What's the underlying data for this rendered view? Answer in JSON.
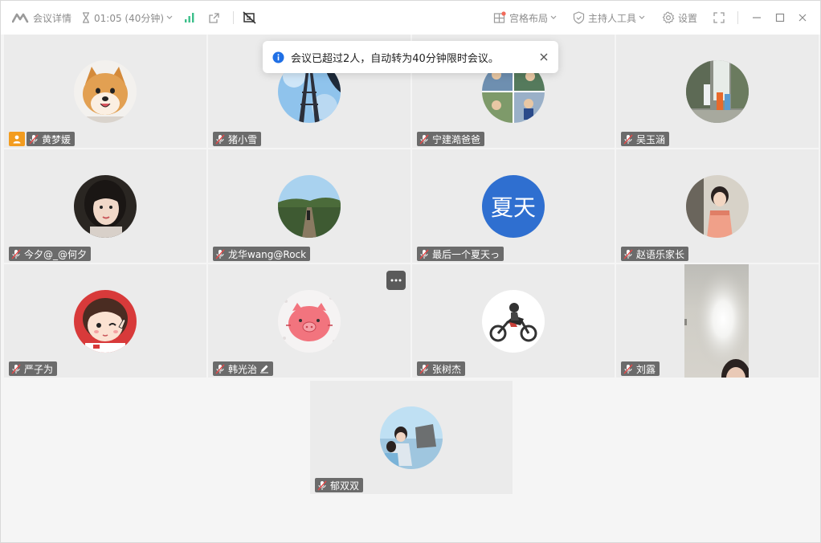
{
  "titlebar": {
    "meeting_details": "会议详情",
    "timer": "01:05 (40分钟)",
    "layout_label": "宫格布局",
    "host_tools_label": "主持人工具",
    "settings_label": "设置"
  },
  "toast": {
    "message": "会议已超过2人，自动转为40分钟限时会议。"
  },
  "participants": [
    {
      "name": "黄梦媛",
      "host": true,
      "avatar": "shiba-dog"
    },
    {
      "name": "猪小雪",
      "avatar": "eiffel-tower"
    },
    {
      "name": "宁建澔爸爸",
      "avatar": "photo-collage"
    },
    {
      "name": "吴玉涵",
      "avatar": "waterfall-family"
    },
    {
      "name": "今夕@_@何夕",
      "avatar": "girl-portrait"
    },
    {
      "name": "龙华wang@Rock",
      "avatar": "forest-bridge"
    },
    {
      "name": "最后一个夏天っ",
      "avatar_text": "夏天",
      "avatar_color": "#2f6fd0"
    },
    {
      "name": "赵语乐家长",
      "avatar": "child-photo"
    },
    {
      "name": "严子为",
      "avatar": "cartoon-girl"
    },
    {
      "name": "韩光治",
      "avatar": "pink-pig",
      "editing": true
    },
    {
      "name": "张树杰",
      "avatar": "motorcycle"
    },
    {
      "name": "刘露",
      "avatar": "camera-video"
    },
    {
      "name": "郁双双",
      "avatar": "seaside-girls"
    }
  ],
  "colors": {
    "accent_blue": "#1f6fe5",
    "host_orange": "#f39c1f",
    "tile_bg": "#ebebeb"
  }
}
